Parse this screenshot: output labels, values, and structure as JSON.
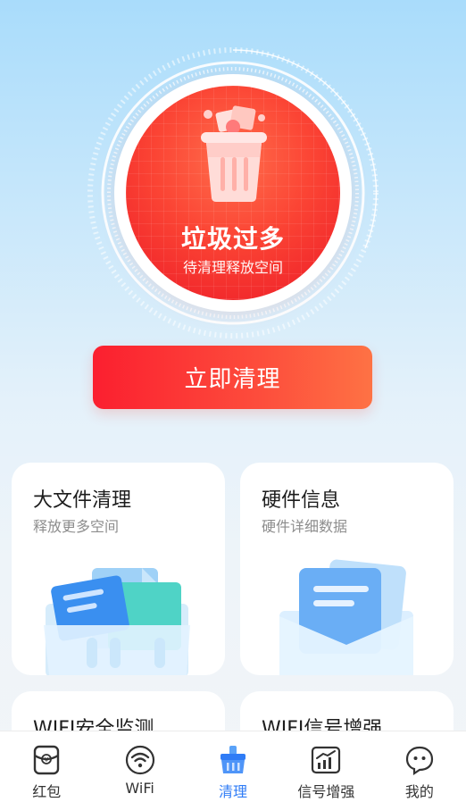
{
  "hero": {
    "status_title": "垃圾过多",
    "status_subtitle": "待清理释放空间",
    "status_color": "#f22a2c"
  },
  "cta": {
    "label": "立即清理",
    "color": "#fb1f2f"
  },
  "cards": [
    {
      "title": "大文件清理",
      "subtitle": "释放更多空间"
    },
    {
      "title": "硬件信息",
      "subtitle": "硬件详细数据"
    },
    {
      "title": "WIFI安全监测",
      "subtitle": ""
    },
    {
      "title": "WIFI信号增强",
      "subtitle": ""
    }
  ],
  "tabbar": {
    "active_color": "#2f7cf6",
    "items": [
      {
        "label": "红包",
        "icon": "red-envelope-icon"
      },
      {
        "label": "WiFi",
        "icon": "wifi-icon"
      },
      {
        "label": "清理",
        "icon": "broom-icon",
        "active": true
      },
      {
        "label": "信号增强",
        "icon": "signal-chart-icon"
      },
      {
        "label": "我的",
        "icon": "profile-icon"
      }
    ]
  }
}
